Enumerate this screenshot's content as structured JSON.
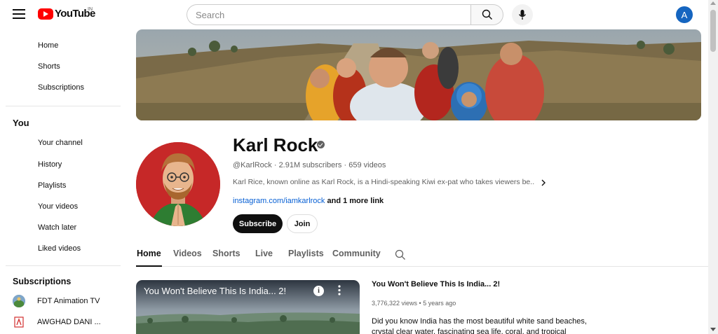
{
  "header": {
    "logo_text": "YouTube",
    "country_code": "IN",
    "search_placeholder": "Search",
    "avatar_letter": "A"
  },
  "sidebar": {
    "main_items": [
      {
        "label": "Home"
      },
      {
        "label": "Shorts"
      },
      {
        "label": "Subscriptions"
      }
    ],
    "you_heading": "You",
    "you_items": [
      {
        "label": "Your channel"
      },
      {
        "label": "History"
      },
      {
        "label": "Playlists"
      },
      {
        "label": "Your videos"
      },
      {
        "label": "Watch later"
      },
      {
        "label": "Liked videos"
      }
    ],
    "subscriptions_heading": "Subscriptions",
    "subscriptions": [
      {
        "label": "FDT Animation TV"
      },
      {
        "label": "AWGHAD DANI ..."
      }
    ]
  },
  "channel": {
    "name": "Karl Rock",
    "meta": "@KarlRock · 2.91M subscribers · 659 videos",
    "description": "Karl Rice, known online as Karl Rock, is a Hindi-speaking Kiwi ex-pat who takes viewers be...",
    "link_text": "instagram.com/iamkarlrock",
    "more_links": "and 1 more link",
    "subscribe_label": "Subscribe",
    "join_label": "Join"
  },
  "tabs": [
    {
      "label": "Home",
      "active": true
    },
    {
      "label": "Videos"
    },
    {
      "label": "Shorts"
    },
    {
      "label": "Live"
    },
    {
      "label": "Playlists"
    },
    {
      "label": "Community"
    }
  ],
  "featured_video": {
    "thumb_title": "You Won't Believe This Is India... 2!",
    "title": "You Won't Believe This Is India... 2!",
    "meta": "3,776,322 views • 5 years ago",
    "description": "Did you know India has the most beautiful white sand beaches, crystal clear water, fascinating sea life, coral, and tropical"
  },
  "colors": {
    "brand_red": "#ff0000",
    "link_blue": "#065fd4",
    "avatar_blue": "#1565c0"
  }
}
